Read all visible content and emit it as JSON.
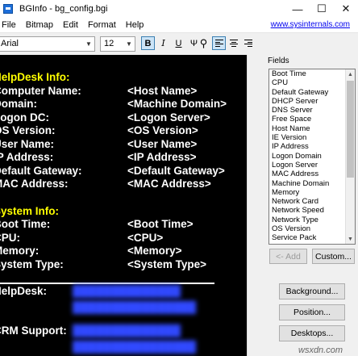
{
  "window": {
    "title": "BGInfo - bg_config.bgi"
  },
  "controls": {
    "minimize": "—",
    "maximize": "☐",
    "close": "✕"
  },
  "menu": [
    "File",
    "Bitmap",
    "Edit",
    "Format",
    "Help"
  ],
  "link": "www.sysinternals.com",
  "toolbar": {
    "font": "Arial",
    "size": "12",
    "bold": "B",
    "italic": "I",
    "underline": "U",
    "color": "Ψ",
    "find": "⚲"
  },
  "content": {
    "helpdesk_header": "HelpDesk Info:",
    "rows1": [
      {
        "label": "Computer Name:",
        "value": "<Host Name>"
      },
      {
        "label": "Domain:",
        "value": "<Machine Domain>"
      },
      {
        "label": "Logon DC:",
        "value": "<Logon Server>"
      },
      {
        "label": "OS Version:",
        "value": "<OS Version>"
      },
      {
        "label": "User Name:",
        "value": "<User Name>"
      },
      {
        "label": "IP Address:",
        "value": "<IP Address>"
      },
      {
        "label": "Default Gateway:",
        "value": "<Default Gateway>"
      },
      {
        "label": "MAC Address:",
        "value": "<MAC Address>"
      }
    ],
    "system_header": "System Info:",
    "rows2": [
      {
        "label": "Boot Time:",
        "value": "<Boot Time>"
      },
      {
        "label": "CPU:",
        "value": "<CPU>"
      },
      {
        "label": "Memory:",
        "value": "<Memory>"
      },
      {
        "label": "System Type:",
        "value": "<System Type>"
      }
    ],
    "helpdesk_label": "HelpDesk:",
    "crm_label": "CRM Support:"
  },
  "fields": {
    "label": "Fields",
    "items": [
      "Boot Time",
      "CPU",
      "Default Gateway",
      "DHCP Server",
      "DNS Server",
      "Free Space",
      "Host Name",
      "IE Version",
      "IP Address",
      "Logon Domain",
      "Logon Server",
      "MAC Address",
      "Machine Domain",
      "Memory",
      "Network Card",
      "Network Speed",
      "Network Type",
      "OS Version",
      "Service Pack"
    ]
  },
  "buttons": {
    "add": "<- Add",
    "custom": "Custom...",
    "background": "Background...",
    "position": "Position...",
    "desktops": "Desktops..."
  },
  "watermark": "wsxdn.com"
}
